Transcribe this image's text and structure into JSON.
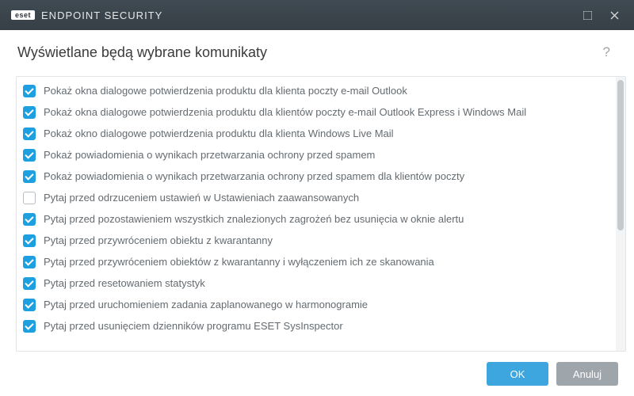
{
  "titlebar": {
    "badge": "eset",
    "product": "ENDPOINT SECURITY"
  },
  "header": {
    "title": "Wyświetlane będą wybrane komunikaty",
    "help": "?"
  },
  "items": [
    {
      "checked": true,
      "label": "Pokaż okna dialogowe potwierdzenia produktu dla klienta poczty e-mail Outlook"
    },
    {
      "checked": true,
      "label": "Pokaż okna dialogowe potwierdzenia produktu dla klientów poczty e-mail Outlook Express i Windows Mail"
    },
    {
      "checked": true,
      "label": "Pokaż okno dialogowe potwierdzenia produktu dla klienta Windows Live Mail"
    },
    {
      "checked": true,
      "label": "Pokaż powiadomienia o wynikach przetwarzania ochrony przed spamem"
    },
    {
      "checked": true,
      "label": "Pokaż powiadomienia o wynikach przetwarzania ochrony przed spamem dla klientów poczty"
    },
    {
      "checked": false,
      "label": "Pytaj przed odrzuceniem ustawień w Ustawieniach zaawansowanych"
    },
    {
      "checked": true,
      "label": "Pytaj przed pozostawieniem wszystkich znalezionych zagrożeń bez usunięcia w oknie alertu"
    },
    {
      "checked": true,
      "label": "Pytaj przed przywróceniem obiektu z kwarantanny"
    },
    {
      "checked": true,
      "label": "Pytaj przed przywróceniem obiektów z kwarantanny i wyłączeniem ich ze skanowania"
    },
    {
      "checked": true,
      "label": "Pytaj przed resetowaniem statystyk"
    },
    {
      "checked": true,
      "label": "Pytaj przed uruchomieniem zadania zaplanowanego w harmonogramie"
    },
    {
      "checked": true,
      "label": "Pytaj przed usunięciem dzienników programu ESET SysInspector"
    }
  ],
  "footer": {
    "ok": "OK",
    "cancel": "Anuluj"
  }
}
